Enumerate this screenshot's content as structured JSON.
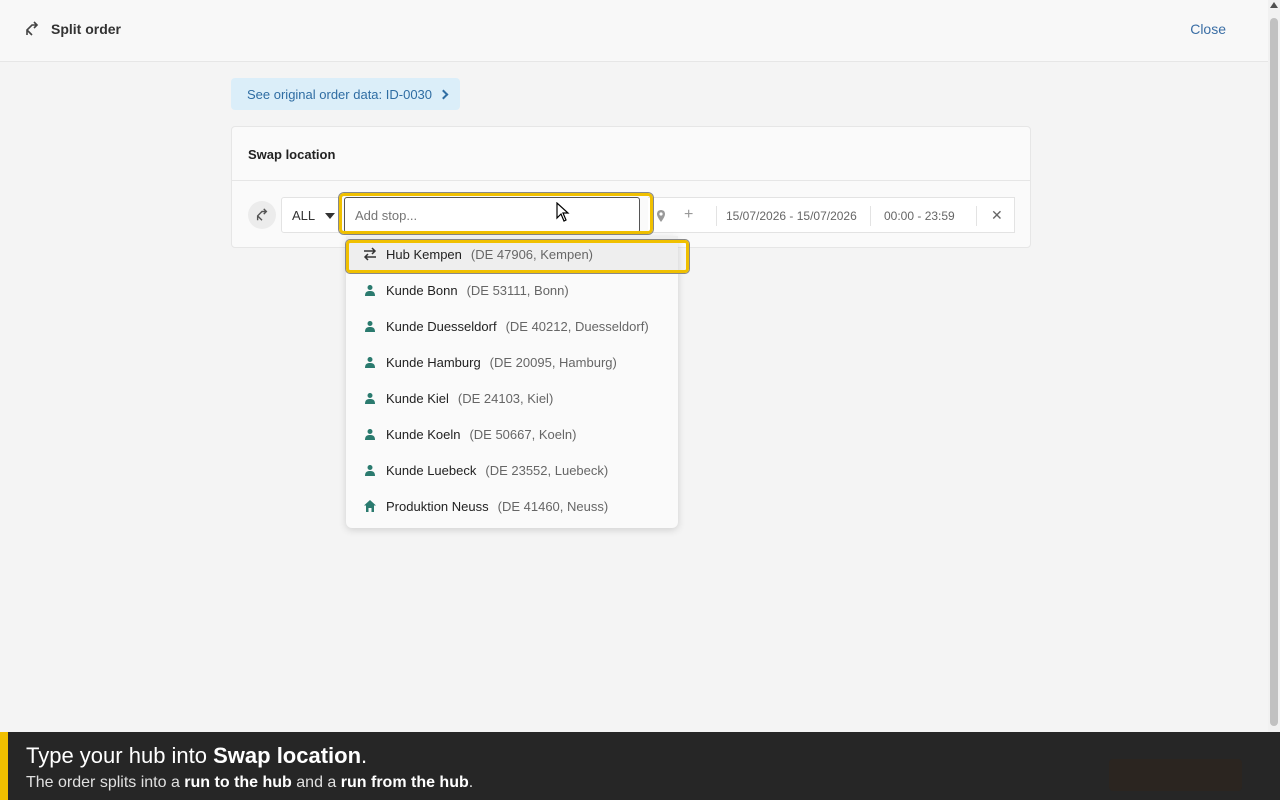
{
  "header": {
    "title": "Split order",
    "close_label": "Close"
  },
  "original_order_link": "See original order data: ID-0030",
  "card": {
    "title": "Swap location"
  },
  "stop_row": {
    "filter_value": "ALL",
    "stop_input_placeholder": "Add stop...",
    "date_range": "15/07/2026 - 15/07/2026",
    "time_range": "00:00 - 23:59"
  },
  "stop_options": [
    {
      "name": "Hub Kempen",
      "meta": "(DE 47906, Kempen)",
      "icon": "swap-icon",
      "active": true
    },
    {
      "name": "Kunde Bonn",
      "meta": "(DE 53111, Bonn)",
      "icon": "person-icon"
    },
    {
      "name": "Kunde Duesseldorf",
      "meta": "(DE 40212, Duesseldorf)",
      "icon": "person-icon"
    },
    {
      "name": "Kunde Hamburg",
      "meta": "(DE 20095, Hamburg)",
      "icon": "person-icon"
    },
    {
      "name": "Kunde Kiel",
      "meta": "(DE 24103, Kiel)",
      "icon": "person-icon"
    },
    {
      "name": "Kunde Koeln",
      "meta": "(DE 50667, Koeln)",
      "icon": "person-icon"
    },
    {
      "name": "Kunde Luebeck",
      "meta": "(DE 23552, Luebeck)",
      "icon": "person-icon"
    },
    {
      "name": "Produktion Neuss",
      "meta": "(DE 41460, Neuss)",
      "icon": "home-icon"
    }
  ],
  "tutorial": {
    "line1_pre": "Type your hub into ",
    "line1_bold": "Swap location",
    "line1_post": ".",
    "line2_pre": "The order splits into a ",
    "line2_bold1": "run to the hub",
    "line2_mid": " and a ",
    "line2_bold2": "run from the hub",
    "line2_post": "."
  },
  "colors": {
    "accent": "#f0c000",
    "link": "#2f6da3",
    "icon_teal": "#2a7a6e"
  }
}
